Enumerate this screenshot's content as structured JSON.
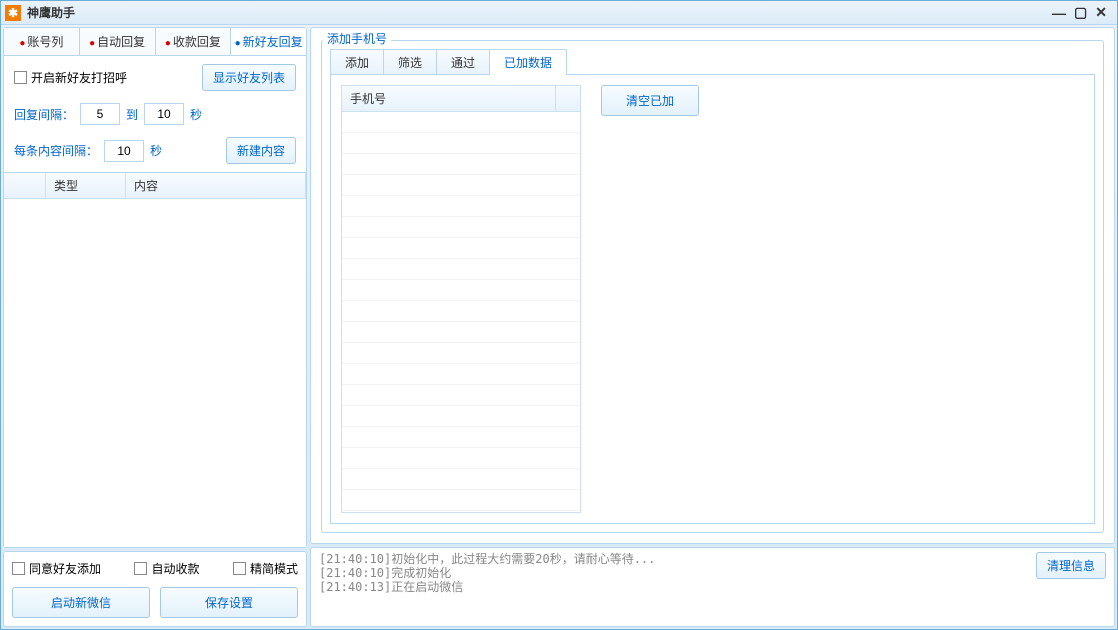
{
  "window": {
    "title": "神鹰助手"
  },
  "leftTabs": {
    "t1": "账号列",
    "t2": "自动回复",
    "t3": "收款回复",
    "t4": "新好友回复"
  },
  "leftPanel": {
    "greetCheckbox": "开启新好友打招呼",
    "showFriendList": "显示好友列表",
    "replyIntervalLabel": "回复间隔：",
    "replyMin": "5",
    "toLabel": "到",
    "replyMax": "10",
    "secondsLabel": "秒",
    "contentIntervalLabel": "每条内容间隔：",
    "contentInterval": "10",
    "newContentBtn": "新建内容",
    "col1": "类型",
    "col2": "内容"
  },
  "leftBottom": {
    "agreeAdd": "同意好友添加",
    "autoCollect": "自动收款",
    "simpleMode": "精简模式",
    "startWechat": "启动新微信",
    "saveSettings": "保存设置"
  },
  "rightPanel": {
    "groupTitle": "添加手机号",
    "tab1": "添加",
    "tab2": "筛选",
    "tab3": "通过",
    "tab4": "已加数据",
    "phoneCol": "手机号",
    "clearAdded": "清空已加"
  },
  "log": {
    "lines": "[21:40:10]初始化中，此过程大约需要20秒，请耐心等待...\n[21:40:10]完成初始化\n[21:40:13]正在启动微信",
    "clearBtn": "清理信息"
  }
}
